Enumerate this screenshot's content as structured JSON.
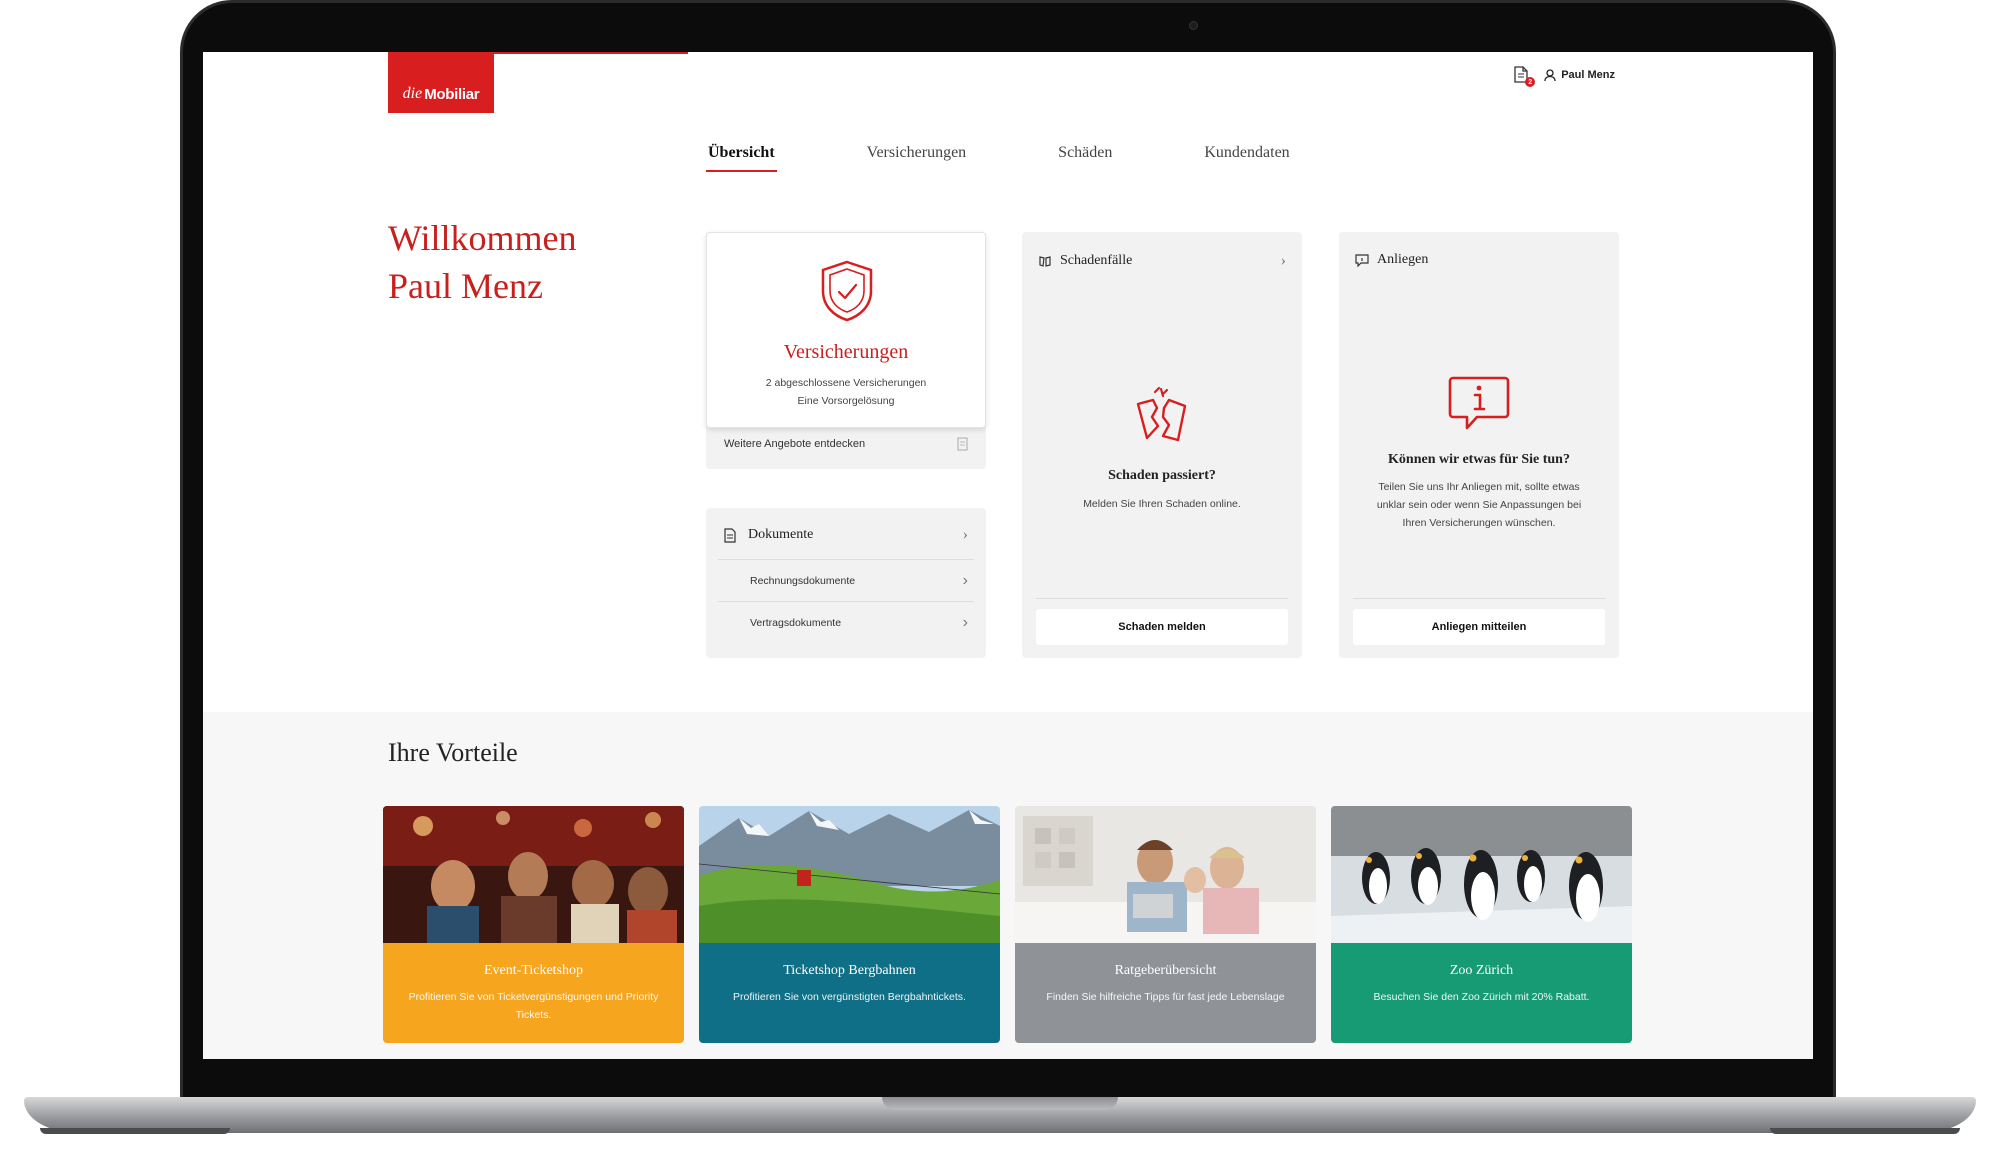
{
  "header": {
    "logo_prefix": "die",
    "logo_brand": "Mobiliar",
    "docs_badge": "2",
    "user_name": "Paul Menz"
  },
  "nav": {
    "items": [
      "Übersicht",
      "Versicherungen",
      "Schäden",
      "Kundendaten"
    ],
    "active": "Übersicht"
  },
  "welcome": {
    "line1": "Willkommen",
    "line2": "Paul Menz"
  },
  "insurance_card": {
    "title": "Versicherungen",
    "line1": "2 abgeschlossene Versicherungen",
    "line2": "Eine Vorsorgelösung",
    "more_link": "Weitere Angebote entdecken"
  },
  "documents_card": {
    "title": "Dokumente",
    "rows": [
      "Rechnungsdokumente",
      "Vertragsdokumente"
    ]
  },
  "claims_card": {
    "header": "Schadenfälle",
    "title": "Schaden passiert?",
    "description": "Melden Sie Ihren Schaden online.",
    "button": "Schaden melden"
  },
  "concerns_card": {
    "header": "Anliegen",
    "title": "Können wir etwas für Sie tun?",
    "description": "Teilen Sie uns Ihr Anliegen mit, sollte etwas unklar sein oder wenn Sie Anpassungen bei Ihren Versicherungen wünschen.",
    "button": "Anliegen mitteilen"
  },
  "advantages": {
    "title": "Ihre Vorteile",
    "items": [
      {
        "title": "Event-Ticketshop",
        "text": "Profitieren Sie von Ticketvergünstigungen und Priority Tickets.",
        "color": "#f6a51e"
      },
      {
        "title": "Ticketshop Bergbahnen",
        "text": "Profitieren Sie von vergünstigten Bergbahntickets.",
        "color": "#0f6f86"
      },
      {
        "title": "Ratgeberübersicht",
        "text": "Finden Sie hilfreiche Tipps für fast jede Lebenslage",
        "color": "#8f9296"
      },
      {
        "title": "Zoo Zürich",
        "text": "Besuchen Sie den Zoo Zürich mit 20% Rabatt.",
        "color": "#169b74"
      }
    ]
  },
  "colors": {
    "brand_red": "#d81e1e",
    "heading_red": "#c8201d"
  }
}
